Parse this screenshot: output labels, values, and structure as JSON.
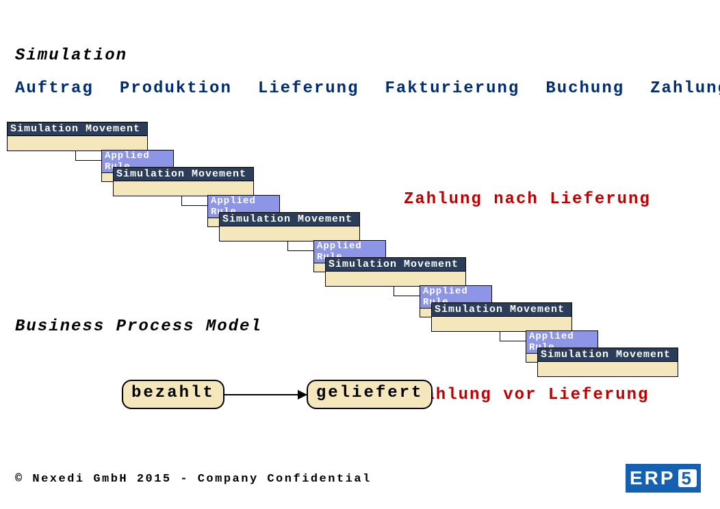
{
  "titles": {
    "simulation": "Simulation",
    "bpm": "Business Process Model"
  },
  "phases": [
    "Auftrag",
    "Produktion",
    "Lieferung",
    "Fakturierung",
    "Buchung",
    "Zahlung"
  ],
  "labels": {
    "simMovement": "Simulation Movement",
    "appliedRule": "Applied Rule",
    "afterDelivery": "Zahlung nach Lieferung",
    "beforeDelivery": "Zahlung vor Lieferung"
  },
  "bpm": {
    "from": "bezahlt",
    "to": "geliefert"
  },
  "footer": "© Nexedi GmbH 2015 - Company Confidential",
  "logo": {
    "text": "ERP",
    "num": "5"
  }
}
